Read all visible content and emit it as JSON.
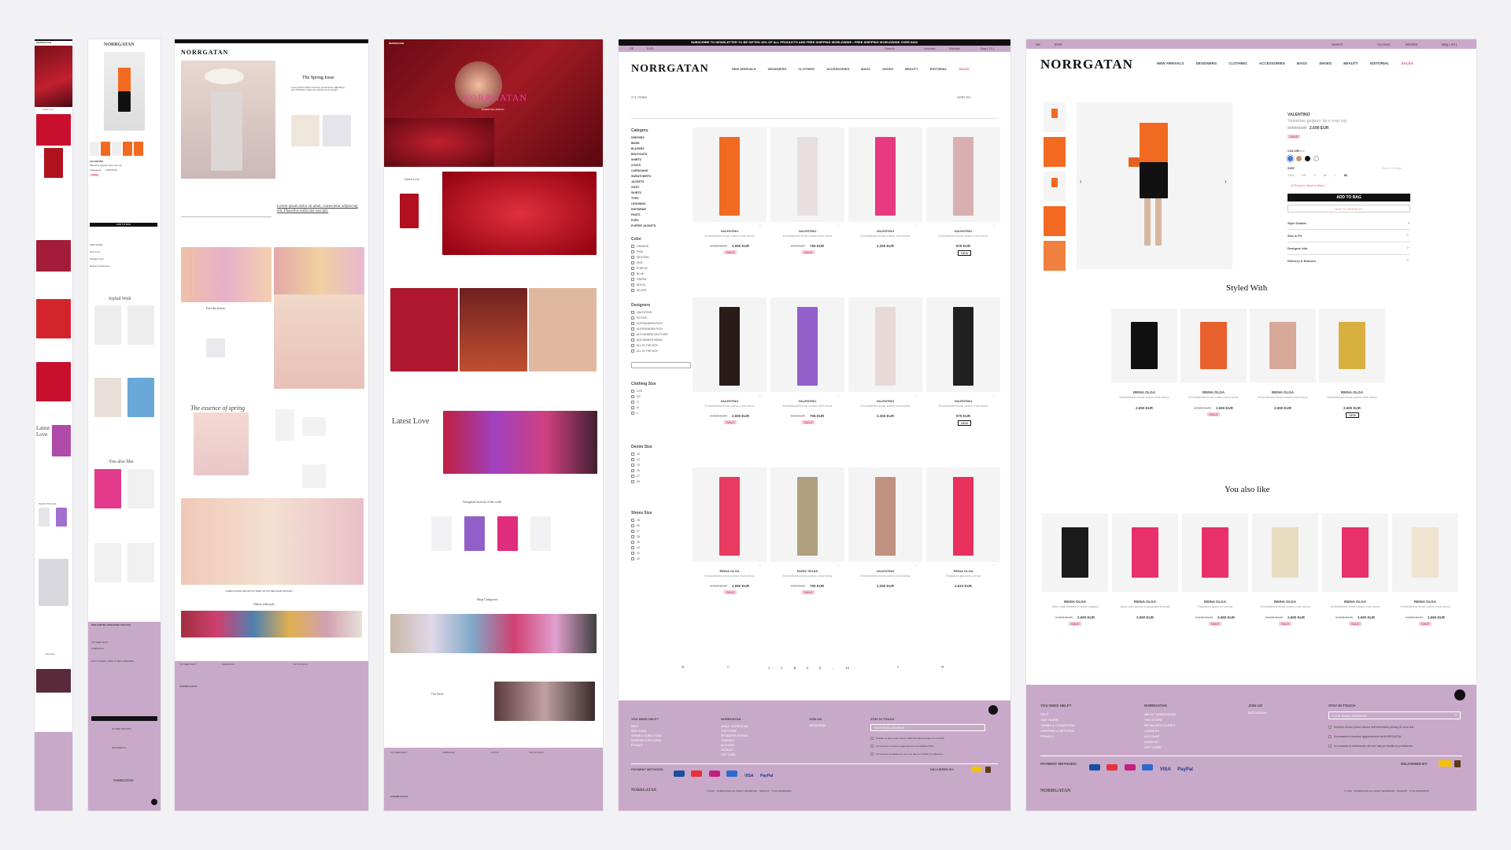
{
  "brand": "NORRGATAN",
  "announcement": "SUBSCRIBE TO NEWSLETTER TO BE GIFTED 10% OF ALL PRODUCTS AND FREE SHIPPING WORLDWIDE • FREE SHIPPING WORLDWIDE OVER €400",
  "topbar": {
    "lang": "SE",
    "currency": "EUR",
    "search": "Search",
    "account": "Account",
    "wishlist": "Wishlist",
    "bag": "Bag | 20 |"
  },
  "nav": [
    "NEW ARRIVALS",
    "DESIGNERS",
    "CLOTHING",
    "ACCESSORIES",
    "BAGS",
    "SHOES",
    "BEAUTY",
    "EDITORIAL",
    "SALES"
  ],
  "mobile_home": {
    "section1": "Latest Love",
    "section2": "Latest Love",
    "fav": "Favorite of the week",
    "store": "Our Store"
  },
  "mobile_product": {
    "designer": "VALENTINO",
    "name": "Valentino guipure lace crop top",
    "old_price": "2.930 EUR",
    "price": "2.690 EUR",
    "sale": "SALE",
    "styled_with": "Styled With",
    "you_also_like": "You also like",
    "add_to_bag": "ADD TO BAG",
    "details": [
      "Style Details",
      "Size & Fit",
      "Designer Info",
      "Delivery & Returns"
    ],
    "free_shipping": "FREE SHIPPING WORLDWIDE OVER 400€",
    "help": "YOU NEED HELP?",
    "norrgatan": "NORRGATAN",
    "newsletter": "ENJOY THANKS GOING TO NEW SUBSCRIBE",
    "payment": "PAYMENT METHODS",
    "delivered": "DELIVERED BY"
  },
  "editorial": {
    "title": "The Spring Issue",
    "intro": "Lorem ipsum dolor sit amet, consectetur adipiscing elit. Phasellus nulla nisi suscipit sed posuere.",
    "quote": "Lorem ipsum dolor sit amet, consectetur adipiscing elit. Phasellus nulla nisi suscipit.",
    "feel": "Feel the breeze",
    "essence": "The essence of spring",
    "others": "Others editorials",
    "load_more": "LOREM IPSUM DOLOR SIT AMET, ELITR SED DIAM NONUMY"
  },
  "home": {
    "hero": "NORRGATAN",
    "hero_sub": "ESSENTIAL SPRING",
    "latest_love": "Latest Love",
    "latest_love2": "Latest Love",
    "fav": "Norrgatan favorite of the week",
    "shop_categories": "Shop Categories",
    "our_store": "Our Store",
    "categories": [
      "CLOTHING",
      "CLOTHING",
      "ACCESSORIES",
      "BAGS",
      "SHOES",
      "BEAUTY"
    ]
  },
  "listing": {
    "count": "271 ITEMS",
    "sort": "SORT BY",
    "filters": {
      "category": "Category",
      "category_items": [
        "DRESSES",
        "BIKINI",
        "BLAZERS",
        "BODYSUITS",
        "SHIRTS",
        "COATS",
        "CARDIGANS",
        "SWEATSHIRTS",
        "JACKETS",
        "GILET",
        "SKIRTS",
        "TOPS",
        "LEGGINGS",
        "KNITWEAR",
        "PANTS",
        "FURS",
        "PUFFER JACKETS"
      ],
      "color": "Color",
      "color_items": [
        "ORANGE",
        "PINK",
        "NEUTRAL",
        "RED",
        "PURPLE",
        "BLUE",
        "GREEN",
        "BLACK",
        "SILVER"
      ],
      "designers": "Designers",
      "designer_items": [
        "VALENTINO",
        "ROTATE",
        "ALESSANDRA RICH",
        "ALESSANDRA RICH",
        "ALEXANDRE VAUTHIER",
        "ALEXANDER WANG",
        "ALL IN THE BOX",
        "ALL IN THE BOX"
      ],
      "clothing_size": "Clothing Size",
      "size_items": [
        "XXS",
        "XS",
        "S",
        "M",
        "L"
      ],
      "denim_size": "Denim Size",
      "denim_items": [
        "23",
        "24",
        "25",
        "26",
        "27",
        "28"
      ],
      "shoes_size": "Shoes Size",
      "shoe_items": [
        "35",
        "36",
        "37",
        "38",
        "39",
        "40",
        "41",
        "42"
      ]
    },
    "products": [
      {
        "designer": "VALENTINO",
        "name": "Embellished floral cotton midi dress",
        "old": "2.930 EUR",
        "price": "2.690 EUR",
        "badge": "SALE"
      },
      {
        "designer": "VALENTINO",
        "name": "Embellished floral cotton midi dress",
        "old": "910 EUR",
        "price": "755 EUR",
        "badge": "SALE"
      },
      {
        "designer": "VALENTINO",
        "name": "Embellished floral cotton midi dress",
        "old": "",
        "price": "2.255 EUR",
        "badge": ""
      },
      {
        "designer": "VALENTINO",
        "name": "Embellished floral cotton midi dress",
        "old": "",
        "price": "975 EUR",
        "badge": "NEW"
      },
      {
        "designer": "VALENTINO",
        "name": "Embellished floral cotton midi dress",
        "old": "2.930 EUR",
        "price": "2.690 EUR",
        "badge": "SALE"
      },
      {
        "designer": "VALENTINO",
        "name": "Embellished floral cotton midi dress",
        "old": "910 EUR",
        "price": "755 EUR",
        "badge": "SALE"
      },
      {
        "designer": "VALENTINO",
        "name": "Embellished floral cotton midi dress",
        "old": "",
        "price": "2.255 EUR",
        "badge": ""
      },
      {
        "designer": "VALENTINO",
        "name": "Embellished floral cotton midi dress",
        "old": "",
        "price": "975 EUR",
        "badge": "NEW"
      },
      {
        "designer": "REINA OLGA",
        "name": "Embellished floral cotton midi dress",
        "old": "2.930 EUR",
        "price": "2.690 EUR",
        "badge": "SALE"
      },
      {
        "designer": "PARIS TEXAS",
        "name": "Embellished floral cotton midi dress",
        "old": "910 EUR",
        "price": "755 EUR",
        "badge": "SALE"
      },
      {
        "designer": "VALENTINO",
        "name": "Embellished floral cotton midi dress",
        "old": "",
        "price": "2.255 EUR",
        "badge": ""
      },
      {
        "designer": "REINA OLGA",
        "name": "Pantaloni gloria in crema",
        "old": "",
        "price": "2.610 EUR",
        "badge": ""
      }
    ],
    "pages": [
      "1",
      "2",
      "3",
      "4",
      "5",
      "...",
      "10"
    ]
  },
  "pdp": {
    "designer": "VALENTINO",
    "name": "Valentino guipure lace crop top",
    "old_price": "2.930 EUR",
    "price": "2.690 EUR",
    "sale": "SALE",
    "color_label": "COLOR",
    "color_value": "Blue",
    "size_label": "SIZE",
    "sizes": [
      "XXS",
      "XS",
      "S",
      "M",
      "L",
      "XL"
    ],
    "size_guide": "Size & Fit Guide",
    "stock": "20 Pieces In Stock In Stock",
    "add_to_bag": "ADD TO BAG",
    "add_to_wishlist": "ADD TO WISHLIST",
    "details": [
      "Style Details",
      "Size & Fit",
      "Designer Info",
      "Delivery & Returns"
    ],
    "styled_with": "Styled With",
    "styled": [
      {
        "designer": "REINA OLGA",
        "name": "Embellished floral cotton midi dress",
        "old": "",
        "price": "2.690 EUR",
        "badge": ""
      },
      {
        "designer": "REINA OLGA",
        "name": "Embellished floral cotton midi dress",
        "old": "2.930 EUR",
        "price": "2.690 EUR",
        "badge": "SALE"
      },
      {
        "designer": "REINA OLGA",
        "name": "Embellished floral cotton midi dress",
        "old": "",
        "price": "2.690 EUR",
        "badge": ""
      },
      {
        "designer": "REINA OLGA",
        "name": "Embellished floral cotton midi dress",
        "old": "",
        "price": "2.690 EUR",
        "badge": "NEW"
      }
    ],
    "you_also_like": "You also like",
    "also": [
      {
        "designer": "REINA OLGA",
        "name": "Abito midi Bettina in pelle vegana",
        "old": "2.930 EUR",
        "price": "2.690 EUR",
        "badge": "SALE"
      },
      {
        "designer": "REINA OLGA",
        "name": "Abito mini gloria in jacquard floreale",
        "old": "",
        "price": "2.690 EUR",
        "badge": ""
      },
      {
        "designer": "REINA OLGA",
        "name": "Pantaloni gloria in crema",
        "old": "2.930 EUR",
        "price": "2.690 EUR",
        "badge": "SALE"
      },
      {
        "designer": "REINA OLGA",
        "name": "Embellished floral cotton midi dress",
        "old": "2.930 EUR",
        "price": "2.690 EUR",
        "badge": "SALE"
      },
      {
        "designer": "REINA OLGA",
        "name": "Embellished floral cotton midi dress",
        "old": "2.930 EUR",
        "price": "2.690 EUR",
        "badge": "SALE"
      },
      {
        "designer": "REINA OLGA",
        "name": "Embellished floral cotton midi dress",
        "old": "2.930 EUR",
        "price": "2.690 EUR",
        "badge": "SALE"
      }
    ]
  },
  "footer": {
    "help_title": "YOU NEED HELP?",
    "help_items": [
      "HELP",
      "SIZE GUIDE",
      "TERMS & CONDITIONS",
      "SHIPPING & RETURNS",
      "PRIVACY"
    ],
    "norr_title": "NORRGATAN",
    "norr_items": [
      "ABOUT NORRGATAN",
      "THE STORE",
      "RETAILERS STORES",
      "CAREERS"
    ],
    "account_items": [
      "ACCOUNT",
      "WISHLIST",
      "GIFT CARD"
    ],
    "join_title": "JOIN US",
    "join_items": [
      "INSTAGRAM"
    ],
    "touch_title": "STAY IN TOUCH",
    "email_placeholder": "YOUR EMAIL ADDRESS",
    "consent1": "Dichiaro di aver preso visione dell'informativa privacy di cui al link.",
    "consent2": "Acconsento a ricevere aggiornamenti da NORRGATAN.",
    "consent3": "Acconsento al trattamento dei miei dati per finalità di profilazione.",
    "payment": "PAYMENT METHODS:",
    "delivered": "DELIVERED BY:",
    "copyright": "© 2019 · NORRGATAN ALL RIGHT RESERVED · MADE BY · P.IVA 0000000000"
  },
  "colors": {
    "lilac": "#c9a9c9",
    "pink": "#e44a8c",
    "orange": "#f26a21",
    "red": "#c8102e",
    "black": "#111111"
  }
}
